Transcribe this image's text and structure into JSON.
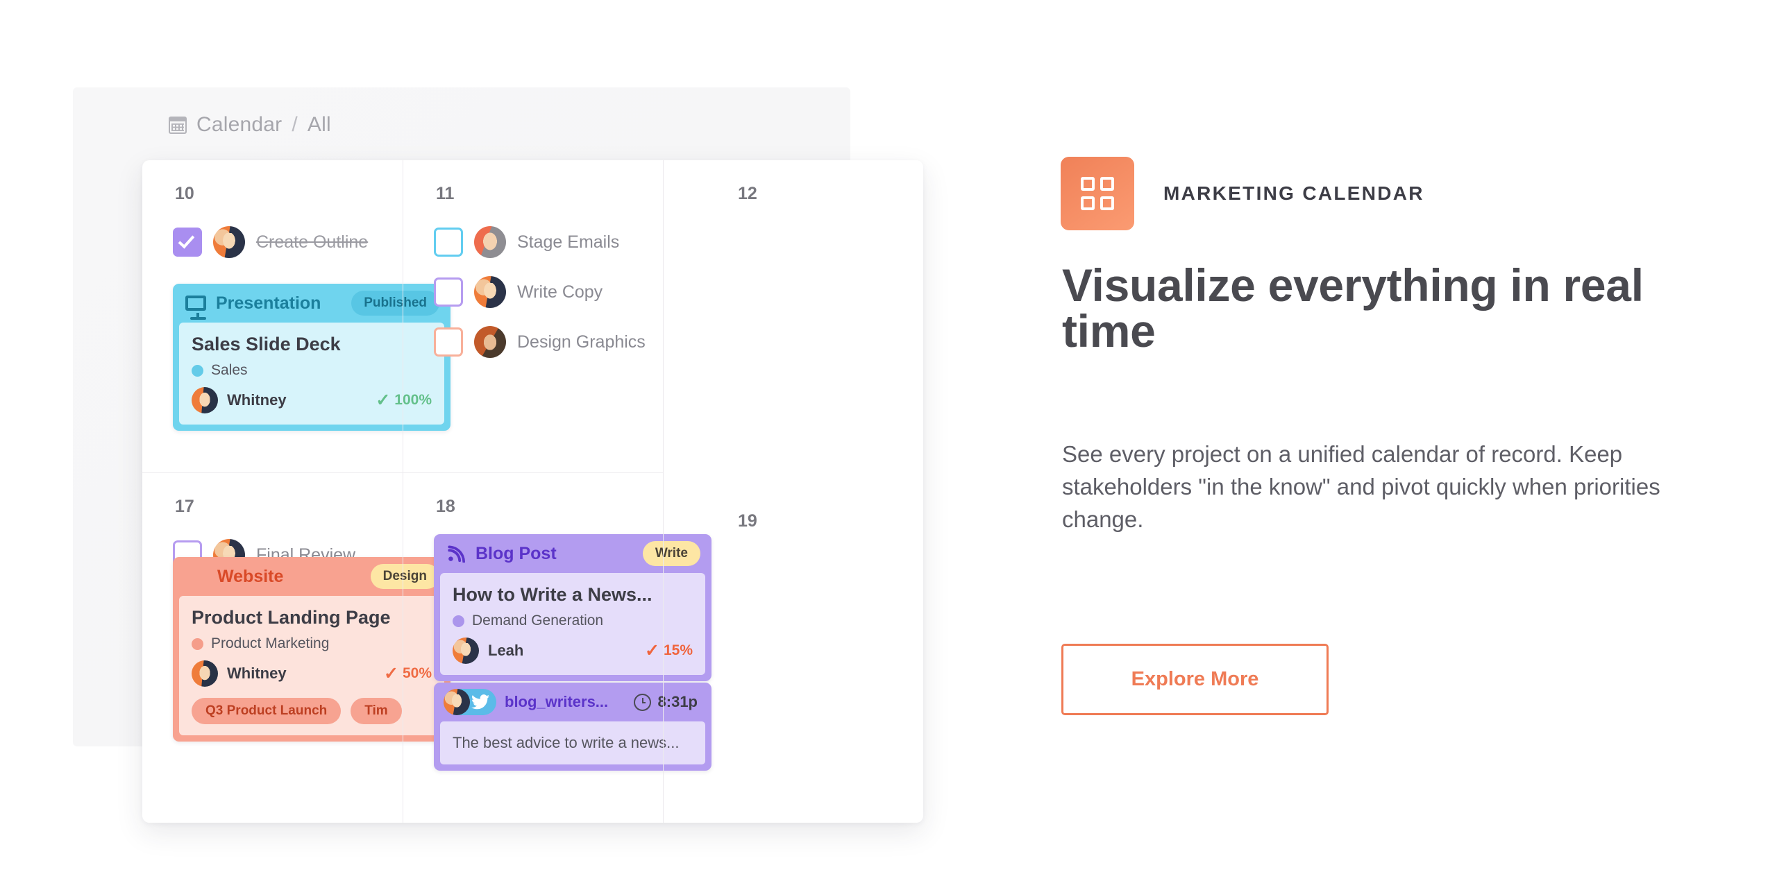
{
  "breadcrumb": {
    "icon": "calendar-icon",
    "root": "Calendar",
    "separator": "/",
    "current": "All"
  },
  "calendar": {
    "days": [
      {
        "number": "10"
      },
      {
        "number": "11"
      },
      {
        "number": "12"
      },
      {
        "number": "17"
      },
      {
        "number": "18"
      },
      {
        "number": "19"
      }
    ],
    "day10": {
      "tasks": [
        {
          "label": "Create Outline",
          "checked": true,
          "color": "#a98ef0",
          "done": true
        }
      ],
      "event": {
        "type": "Presentation",
        "status": "Published",
        "title": "Sales Slide Deck",
        "list": "Sales",
        "assignee": "Whitney",
        "progress": "100%",
        "check": "✓",
        "icon": "presentation-screen-icon",
        "accent": "#6fd4ee"
      }
    },
    "day11": {
      "tasks": [
        {
          "label": "Stage Emails",
          "checked": false,
          "color": "#62cdf0"
        },
        {
          "label": "Write Copy",
          "checked": false,
          "color": "#b69cf0"
        },
        {
          "label": "Design Graphics",
          "checked": false,
          "color": "#f8b09a"
        }
      ]
    },
    "day17": {
      "tasks": [
        {
          "label": "Final Review",
          "checked": false,
          "color": "#b69cf0"
        }
      ],
      "event": {
        "type": "Website",
        "status": "Design",
        "title": "Product Landing Page",
        "list": "Product Marketing",
        "assignee": "Whitney",
        "progress": "50%",
        "check": "✓",
        "icon": "laptop-icon",
        "accent": "#f8a290",
        "chips": [
          "Q3 Product Launch",
          "Tim"
        ]
      }
    },
    "day18": {
      "event": {
        "type": "Blog Post",
        "status": "Write",
        "title": "How to Write a News...",
        "list": "Demand Generation",
        "assignee": "Leah",
        "progress": "15%",
        "check": "✓",
        "icon": "rss-icon",
        "accent": "#b39cf0"
      },
      "tweet": {
        "handle": "blog_writers...",
        "time": "8:31p",
        "icon": "twitter-icon",
        "clock_icon": "clock-icon",
        "text": "The best advice to write a news..."
      }
    }
  },
  "promo": {
    "icon": "grid-squares-icon",
    "kicker": "MARKETING CALENDAR",
    "title": "Visualize everything in real time",
    "body": "See every project on a unified calendar of record. Keep stakeholders \"in the know\" and pivot quickly when priorities change.",
    "button": "Explore More",
    "accent": "#ef7b55"
  }
}
